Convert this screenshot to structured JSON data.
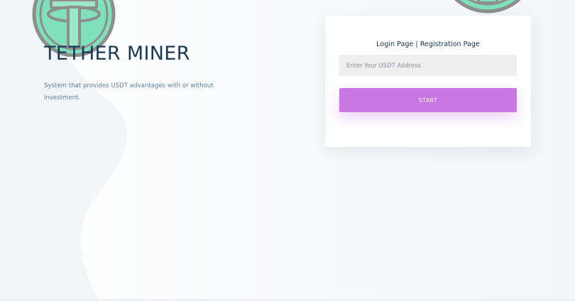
{
  "colors": {
    "page_bg": "#f6f8fa",
    "title": "#183a57",
    "description": "#5c7ea8",
    "button": "#c977e3",
    "coin_fill": "#7fe0bd",
    "coin_stroke": "#8e8e8e"
  },
  "icons": {
    "hero_coin": "tether-coin-icon",
    "corner_coin": "tether-coin-icon"
  },
  "hero": {
    "title": "TETHER MINER",
    "description": "System that provides USDT advantages with or without investment."
  },
  "login_card": {
    "login_link": "Login Page",
    "separator": " | ",
    "registration_link": "Registration Page",
    "address_input": {
      "value": "",
      "placeholder": "Enter Your USDT Address"
    },
    "start_label": "START"
  }
}
